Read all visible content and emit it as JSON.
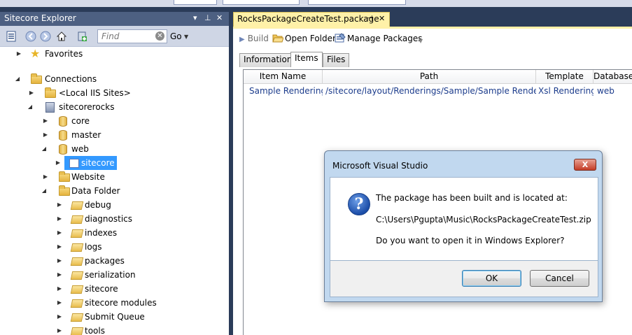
{
  "explorer": {
    "title": "Sitecore Explorer",
    "find_placeholder": "Find",
    "go_label": "Go",
    "tree": [
      {
        "label": "Favorites",
        "icon": "star-icon"
      },
      {
        "label": "Connections",
        "icon": "folder-icon"
      },
      {
        "label": "<Local IIS Sites>",
        "icon": "folder-icon"
      },
      {
        "label": "sitecorerocks",
        "icon": "server-icon"
      },
      {
        "label": "core",
        "icon": "database-icon"
      },
      {
        "label": "master",
        "icon": "database-icon"
      },
      {
        "label": "web",
        "icon": "database-icon"
      },
      {
        "label": "sitecore",
        "icon": "item-icon"
      },
      {
        "label": "Website",
        "icon": "folder-icon"
      },
      {
        "label": "Data Folder",
        "icon": "folder-icon"
      },
      {
        "label": "debug",
        "icon": "folder-open-icon"
      },
      {
        "label": "diagnostics",
        "icon": "folder-open-icon"
      },
      {
        "label": "indexes",
        "icon": "folder-open-icon"
      },
      {
        "label": "logs",
        "icon": "folder-open-icon"
      },
      {
        "label": "packages",
        "icon": "folder-open-icon"
      },
      {
        "label": "serialization",
        "icon": "folder-open-icon"
      },
      {
        "label": "sitecore",
        "icon": "folder-open-icon"
      },
      {
        "label": "sitecore modules",
        "icon": "folder-open-icon"
      },
      {
        "label": "Submit Queue",
        "icon": "folder-open-icon"
      },
      {
        "label": "tools",
        "icon": "folder-open-icon"
      }
    ]
  },
  "document": {
    "tab_title": "RocksPackageCreateTest.package",
    "toolbar": {
      "build": "Build",
      "open_folder": "Open Folder",
      "manage_packages": "Manage Packages"
    },
    "subtabs": [
      "Information",
      "Items",
      "Files"
    ],
    "active_subtab": "Items",
    "grid": {
      "columns": [
        "Item Name",
        "Path",
        "Template",
        "Database"
      ],
      "rows": [
        [
          "Sample Rendering",
          "/sitecore/layout/Renderings/Sample/Sample Rendering",
          "Xsl Rendering",
          "web"
        ]
      ]
    }
  },
  "dialog": {
    "title": "Microsoft Visual Studio",
    "close_label": "X",
    "line1": "The package has been built and is located at:",
    "line2": "C:\\Users\\Pgupta\\Music\\RocksPackageCreateTest.zip",
    "line3": "Do you want to open it in Windows Explorer?",
    "ok": "OK",
    "cancel": "Cancel"
  },
  "colors": {
    "titlebar": "#4d6082",
    "doc_tab": "#fff1a8",
    "selection": "#3399ff",
    "link_text": "#1c3c8c"
  }
}
